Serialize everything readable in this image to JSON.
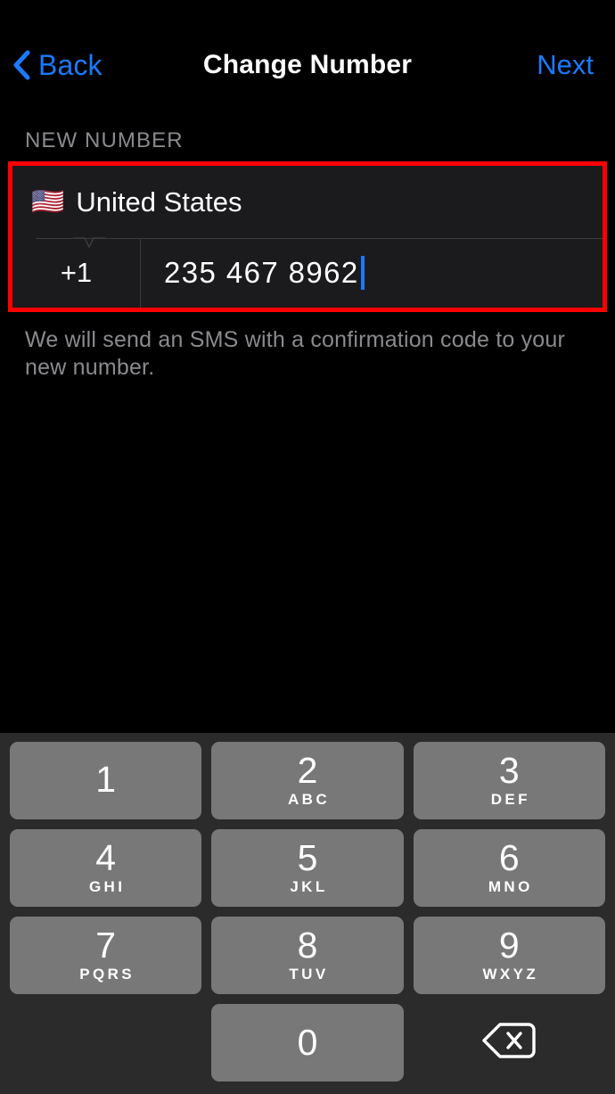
{
  "navbar": {
    "back_label": "Back",
    "back_icon": "chevron-left-icon",
    "title": "Change Number",
    "next_label": "Next"
  },
  "form": {
    "section_header": "NEW NUMBER",
    "country_flag": "🇺🇸",
    "country_name": "United States",
    "country_code": "+1",
    "phone_number": "235 467 8962",
    "footnote": "We will send an SMS with a confirmation code to your new number."
  },
  "colors": {
    "accent_blue": "#1a7bff",
    "highlight_red": "#ff0000",
    "field_background": "#1b1b1d",
    "keypad_background": "#2b2b2b",
    "key_fill": "#787878",
    "muted_text": "#8a8a8f"
  },
  "keypad": {
    "rows": [
      [
        {
          "digit": "1",
          "letters": ""
        },
        {
          "digit": "2",
          "letters": "ABC"
        },
        {
          "digit": "3",
          "letters": "DEF"
        }
      ],
      [
        {
          "digit": "4",
          "letters": "GHI"
        },
        {
          "digit": "5",
          "letters": "JKL"
        },
        {
          "digit": "6",
          "letters": "MNO"
        }
      ],
      [
        {
          "digit": "7",
          "letters": "PQRS"
        },
        {
          "digit": "8",
          "letters": "TUV"
        },
        {
          "digit": "9",
          "letters": "WXYZ"
        }
      ]
    ],
    "bottom": {
      "digit": "0",
      "letters": "",
      "backspace_icon": "backspace-delete-icon"
    }
  }
}
